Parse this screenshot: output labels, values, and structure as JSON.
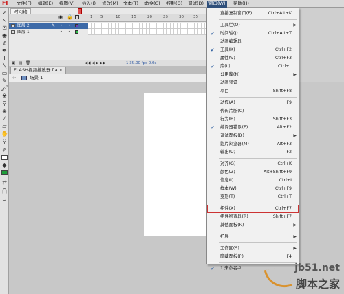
{
  "menubar": {
    "logo": "Fl",
    "items": [
      "文件(F)",
      "编辑(E)",
      "视图(V)",
      "插入(I)",
      "修改(M)",
      "文本(T)",
      "命令(C)",
      "控制(O)",
      "调试(D)",
      "窗口(W)",
      "帮助(H)"
    ],
    "active_index": 9
  },
  "timeline": {
    "tab_label": "时间轴",
    "ruler_numbers": [
      "1",
      "5",
      "10",
      "15",
      "20",
      "25",
      "30",
      "35",
      "40"
    ],
    "layers": [
      {
        "name": "图层 2",
        "selected": true
      },
      {
        "name": "图层 1",
        "selected": false
      }
    ],
    "controls_text": "1    35.00 fps   0.0s"
  },
  "document": {
    "tab_label": "FLASH视频播放器.fla ×",
    "scene_label": "场景 1"
  },
  "window_menu": {
    "items": [
      {
        "label": "直接复制窗口(F)",
        "shortcut": "Ctrl+Alt+K",
        "checked": false,
        "submenu": false
      },
      {
        "sep": true
      },
      {
        "label": "工具栏(O)",
        "shortcut": "",
        "checked": false,
        "submenu": true
      },
      {
        "label": "时间轴(J)",
        "shortcut": "Ctrl+Alt+T",
        "checked": true,
        "submenu": false
      },
      {
        "label": "动画编辑器",
        "shortcut": "",
        "checked": false,
        "submenu": false
      },
      {
        "label": "工具(K)",
        "shortcut": "Ctrl+F2",
        "checked": true,
        "submenu": false
      },
      {
        "label": "属性(V)",
        "shortcut": "Ctrl+F3",
        "checked": false,
        "submenu": false
      },
      {
        "label": "库(L)",
        "shortcut": "Ctrl+L",
        "checked": true,
        "submenu": false
      },
      {
        "label": "公用库(N)",
        "shortcut": "",
        "checked": false,
        "submenu": true
      },
      {
        "label": "动画预设",
        "shortcut": "",
        "checked": false,
        "submenu": false
      },
      {
        "label": "项目",
        "shortcut": "Shift+F8",
        "checked": false,
        "submenu": false
      },
      {
        "sep": true
      },
      {
        "label": "动作(A)",
        "shortcut": "F9",
        "checked": false,
        "submenu": false
      },
      {
        "label": "代码片断(C)",
        "shortcut": "",
        "checked": false,
        "submenu": false
      },
      {
        "label": "行为(B)",
        "shortcut": "Shift+F3",
        "checked": false,
        "submenu": false
      },
      {
        "label": "编译器错误(E)",
        "shortcut": "Alt+F2",
        "checked": true,
        "submenu": false
      },
      {
        "label": "调试面板(D)",
        "shortcut": "",
        "checked": false,
        "submenu": true
      },
      {
        "label": "影片浏览器(M)",
        "shortcut": "Alt+F3",
        "checked": false,
        "submenu": false
      },
      {
        "label": "输出(U)",
        "shortcut": "F2",
        "checked": false,
        "submenu": false
      },
      {
        "sep": true
      },
      {
        "label": "对齐(G)",
        "shortcut": "Ctrl+K",
        "checked": false,
        "submenu": false
      },
      {
        "label": "颜色(Z)",
        "shortcut": "Alt+Shift+F9",
        "checked": false,
        "submenu": false
      },
      {
        "label": "信息(I)",
        "shortcut": "Ctrl+I",
        "checked": false,
        "submenu": false
      },
      {
        "label": "样本(W)",
        "shortcut": "Ctrl+F9",
        "checked": false,
        "submenu": false
      },
      {
        "label": "变形(T)",
        "shortcut": "Ctrl+T",
        "checked": false,
        "submenu": false
      },
      {
        "sep": true
      },
      {
        "label": "组件(X)",
        "shortcut": "Ctrl+F7",
        "checked": false,
        "submenu": false,
        "highlight": true
      },
      {
        "label": "组件检查器(R)",
        "shortcut": "Shift+F7",
        "checked": false,
        "submenu": false
      },
      {
        "label": "其他面板(R)",
        "shortcut": "",
        "checked": false,
        "submenu": true
      },
      {
        "sep": true
      },
      {
        "label": "扩展",
        "shortcut": "",
        "checked": false,
        "submenu": true
      },
      {
        "sep": true
      },
      {
        "label": "工作区(S)",
        "shortcut": "",
        "checked": false,
        "submenu": true
      },
      {
        "label": "隐藏面板(P)",
        "shortcut": "F4",
        "checked": false,
        "submenu": false
      },
      {
        "sep": true
      },
      {
        "label": "1 未命名-2",
        "shortcut": "",
        "checked": true,
        "submenu": false
      }
    ]
  },
  "watermark": {
    "site": "jb51.net",
    "text": "脚本之家"
  }
}
